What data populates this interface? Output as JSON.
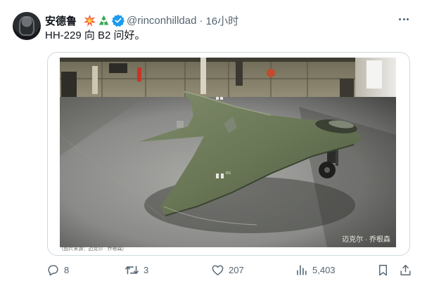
{
  "post": {
    "author_name": "安德鲁",
    "handle": "@rinconhilldad",
    "separator": "·",
    "timestamp": "16小时",
    "text": "HH-229 向 B2 问好。",
    "badge_emojis": [
      "explosion-emoji",
      "recycle-emoji"
    ],
    "verified_color": "#1d9bf0"
  },
  "media": {
    "photo_credit": "迈克尔 · 乔根森",
    "caption": "(图片来源：迈克尔 · 乔根森)"
  },
  "actions": {
    "replies": "8",
    "reposts": "3",
    "likes": "207",
    "views": "5,403"
  }
}
